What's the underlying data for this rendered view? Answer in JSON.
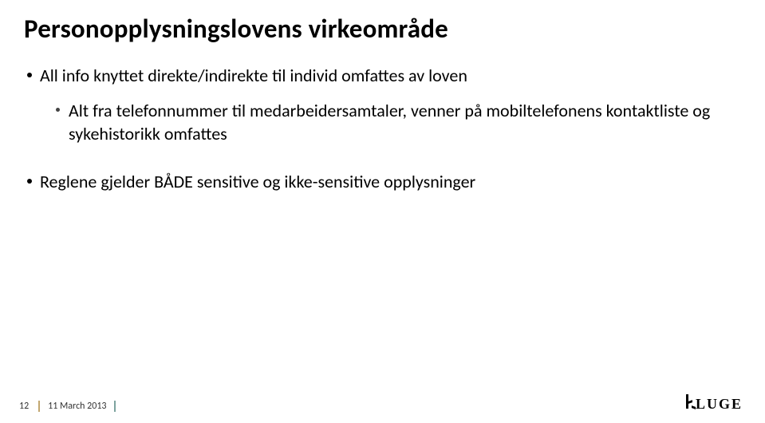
{
  "title": "Personopplysningslovens virkeområde",
  "bullets": {
    "b1": "All info knyttet direkte/indirekte til individ omfattes av loven",
    "b2": "Alt fra telefonnummer til medarbeidersamtaler, venner på mobiltelefonens kontaktliste og sykehistorikk omfattes",
    "b3": "Reglene gjelder BÅDE sensitive og ikke-sensitive opplysninger"
  },
  "footer": {
    "page": "12",
    "date": "11 March 2013",
    "logo": "KLUGE"
  }
}
